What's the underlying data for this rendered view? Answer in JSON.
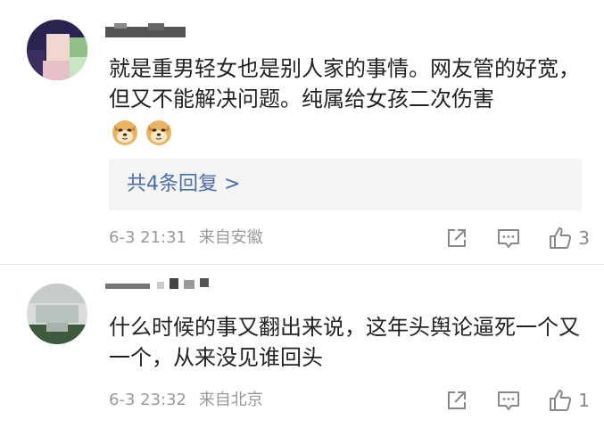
{
  "comments": [
    {
      "text": "就是重男轻女也是别人家的事情。网友管的好宽，但又不能解决问题。纯属给女孩二次伤害",
      "emojis": [
        "doge-icon",
        "doge-icon"
      ],
      "replies_label": "共4条回复 >",
      "date": "6-3 21:31",
      "source": "来自安徽",
      "like_count": "3"
    },
    {
      "text": "什么时候的事又翻出来说，这年头舆论逼死一个又一个，从来没见谁回头",
      "date": "6-3 23:32",
      "source": "来自北京",
      "like_count": "1"
    }
  ],
  "colors": {
    "link": "#4a6fa5",
    "meta": "#999999",
    "reply_bg": "#f4f4f4"
  }
}
